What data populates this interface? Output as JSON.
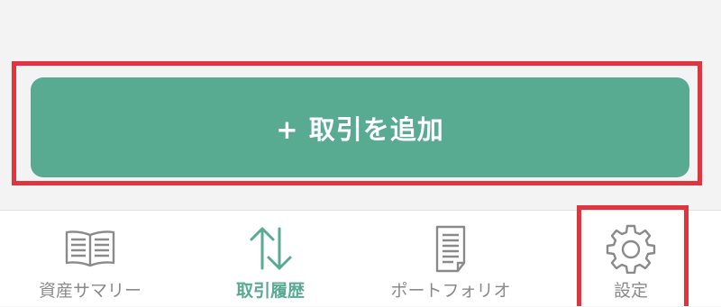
{
  "add_button": {
    "label": "+ 取引を追加"
  },
  "tabs": [
    {
      "label": "資産サマリー",
      "icon": "book-icon",
      "active": false
    },
    {
      "label": "取引履歴",
      "icon": "transfer-arrows-icon",
      "active": true
    },
    {
      "label": "ポートフォリオ",
      "icon": "document-icon",
      "active": false
    },
    {
      "label": "設定",
      "icon": "gear-icon",
      "active": false
    }
  ],
  "colors": {
    "accent": "#58aa91",
    "highlight": "#e0343f",
    "inactive": "#8a8a8a",
    "background": "#f3f3f3"
  }
}
